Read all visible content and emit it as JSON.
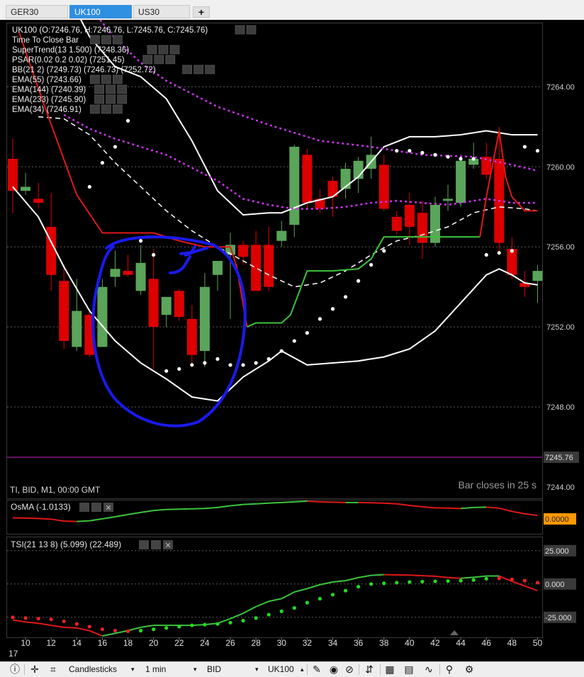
{
  "tabs": [
    {
      "label": "GER30"
    },
    {
      "label": "UK100"
    },
    {
      "label": "US30"
    }
  ],
  "add_tab_label": "+",
  "main": {
    "legend": [
      "UK100 (O:7246.76, H:7246.76, L:7245.76, C:7245.76)",
      "Time To Close Bar",
      "SuperTrend(13 1.500) (7248.36)",
      "PSAR(0.02 0.2 0.02) (7251.45)",
      "BB(21 2) (7249.73) (7246.73) (7252.72)",
      "EMA(55) (7243.66)",
      "EMA(144) (7240.39)",
      "EMA(233) (7245.90)",
      "EMA(34) (7246.91)"
    ],
    "y_labels": [
      "7264.00",
      "7260.00",
      "7256.00",
      "7252.00",
      "7248.00",
      "7244.00"
    ],
    "current_price": "7245.76",
    "info_text": "TI, BID, M1, 00:00 GMT",
    "bar_close_text": "Bar closes in 25 s"
  },
  "osma": {
    "title": "OsMA (-1.0133)",
    "value_label": "0.0000"
  },
  "tsi": {
    "title": "TSI(21 13 8) (5.099) (22.489)",
    "y_labels": [
      "25.000",
      "0.000",
      "-25.000"
    ]
  },
  "x_axis": {
    "labels": [
      "10",
      "12",
      "14",
      "16",
      "18",
      "20",
      "22",
      "24",
      "26",
      "28",
      "30",
      "32",
      "34",
      "36",
      "38",
      "40",
      "42",
      "44",
      "46",
      "48",
      "50"
    ],
    "corner": "17"
  },
  "toolbar": {
    "chart_type": "Candlesticks",
    "timeframe": "1 min",
    "price_type": "BID",
    "symbol": "UK100"
  },
  "colors": {
    "bull": "#5aa55a",
    "bear": "#dd0000",
    "supertrend_up": "#3cc43c",
    "supertrend_down": "#e01818",
    "ema_dotted": "#cc33ee",
    "annotation": "#1a1aee",
    "price_line": "#d020d0"
  },
  "chart_data": {
    "type": "candlestick",
    "x": [
      9,
      10,
      11,
      12,
      13,
      14,
      15,
      16,
      17,
      18,
      19,
      20,
      21,
      22,
      23,
      24,
      25,
      26,
      27,
      28,
      29,
      30,
      31,
      32,
      33,
      34,
      35,
      36,
      37,
      38,
      39,
      40,
      41,
      42,
      43,
      44,
      45,
      46,
      47,
      48,
      49,
      50
    ],
    "candles": [
      {
        "o": 7260.4,
        "h": 7261.4,
        "l": 7257.7,
        "c": 7258.8
      },
      {
        "o": 7258.8,
        "h": 7259.7,
        "l": 7258.6,
        "c": 7259.0
      },
      {
        "o": 7258.4,
        "h": 7259.2,
        "l": 7257.9,
        "c": 7258.2
      },
      {
        "o": 7257.0,
        "h": 7258.7,
        "l": 7253.8,
        "c": 7254.6
      },
      {
        "o": 7254.3,
        "h": 7255.1,
        "l": 7250.9,
        "c": 7251.3
      },
      {
        "o": 7251.0,
        "h": 7254.4,
        "l": 7250.8,
        "c": 7252.8
      },
      {
        "o": 7252.6,
        "h": 7252.8,
        "l": 7250.5,
        "c": 7250.6
      },
      {
        "o": 7251.0,
        "h": 7254.4,
        "l": 7251.0,
        "c": 7254.0
      },
      {
        "o": 7254.5,
        "h": 7255.8,
        "l": 7254.0,
        "c": 7254.9
      },
      {
        "o": 7254.8,
        "h": 7255.6,
        "l": 7254.5,
        "c": 7254.6
      },
      {
        "o": 7253.8,
        "h": 7256.1,
        "l": 7253.6,
        "c": 7255.2
      },
      {
        "o": 7254.4,
        "h": 7255.9,
        "l": 7249.9,
        "c": 7252.0
      },
      {
        "o": 7252.6,
        "h": 7253.3,
        "l": 7252.0,
        "c": 7253.5
      },
      {
        "o": 7253.8,
        "h": 7253.9,
        "l": 7252.3,
        "c": 7252.5
      },
      {
        "o": 7252.4,
        "h": 7253.1,
        "l": 7250.2,
        "c": 7250.6
      },
      {
        "o": 7250.8,
        "h": 7254.7,
        "l": 7250.0,
        "c": 7254.0
      },
      {
        "o": 7254.6,
        "h": 7255.3,
        "l": 7253.8,
        "c": 7255.3
      },
      {
        "o": 7255.6,
        "h": 7256.7,
        "l": 7252.4,
        "c": 7256.1
      },
      {
        "o": 7256.1,
        "h": 7256.3,
        "l": 7255.1,
        "c": 7255.5
      },
      {
        "o": 7256.1,
        "h": 7256.8,
        "l": 7253.8,
        "c": 7253.8
      },
      {
        "o": 7256.1,
        "h": 7257.0,
        "l": 7253.8,
        "c": 7254.0
      },
      {
        "o": 7256.3,
        "h": 7257.3,
        "l": 7256.0,
        "c": 7256.8
      },
      {
        "o": 7257.1,
        "h": 7261.1,
        "l": 7256.5,
        "c": 7261.0
      },
      {
        "o": 7260.6,
        "h": 7260.9,
        "l": 7257.9,
        "c": 7258.2
      },
      {
        "o": 7258.4,
        "h": 7258.9,
        "l": 7257.7,
        "c": 7257.9
      },
      {
        "o": 7259.3,
        "h": 7259.5,
        "l": 7257.5,
        "c": 7258.5
      },
      {
        "o": 7258.9,
        "h": 7260.2,
        "l": 7258.4,
        "c": 7259.9
      },
      {
        "o": 7259.4,
        "h": 7260.5,
        "l": 7258.7,
        "c": 7260.3
      },
      {
        "o": 7259.9,
        "h": 7261.5,
        "l": 7259.4,
        "c": 7260.6
      },
      {
        "o": 7260.1,
        "h": 7260.6,
        "l": 7257.8,
        "c": 7257.9
      },
      {
        "o": 7257.5,
        "h": 7257.8,
        "l": 7256.6,
        "c": 7256.8
      },
      {
        "o": 7258.1,
        "h": 7258.7,
        "l": 7256.1,
        "c": 7257.0
      },
      {
        "o": 7257.7,
        "h": 7258.3,
        "l": 7255.4,
        "c": 7256.2
      },
      {
        "o": 7256.2,
        "h": 7258.5,
        "l": 7256.0,
        "c": 7258.1
      },
      {
        "o": 7258.3,
        "h": 7259.1,
        "l": 7257.8,
        "c": 7258.4
      },
      {
        "o": 7258.2,
        "h": 7260.6,
        "l": 7258.0,
        "c": 7260.3
      },
      {
        "o": 7260.1,
        "h": 7261.2,
        "l": 7259.9,
        "c": 7260.4
      },
      {
        "o": 7260.5,
        "h": 7261.2,
        "l": 7259.4,
        "c": 7259.6
      },
      {
        "o": 7260.4,
        "h": 7262.0,
        "l": 7255.6,
        "c": 7256.2
      },
      {
        "o": 7255.9,
        "h": 7256.5,
        "l": 7254.4,
        "c": 7254.6
      },
      {
        "o": 7254.2,
        "h": 7254.8,
        "l": 7253.5,
        "c": 7254.0
      },
      {
        "o": 7254.3,
        "h": 7255.1,
        "l": 7253.2,
        "c": 7254.8
      }
    ],
    "xlim": [
      9,
      50
    ],
    "ylim": [
      7243.4,
      7267.2
    ],
    "y_ticks": [
      7244,
      7248,
      7252,
      7256,
      7260,
      7264
    ],
    "bb_upper": [
      [
        9,
        7259.0
      ],
      [
        11,
        7257.5
      ],
      [
        13,
        7255.0
      ],
      [
        15,
        7252.8
      ],
      [
        17,
        7251.3
      ],
      [
        19,
        7250.2
      ],
      [
        21,
        7249.4
      ],
      [
        23,
        7248.5
      ],
      [
        25,
        7248.3
      ],
      [
        27,
        7249.5
      ],
      [
        29,
        7250.3
      ],
      [
        30,
        7250.8
      ],
      [
        32,
        7250.1
      ],
      [
        34,
        7250.2
      ],
      [
        36,
        7250.3
      ],
      [
        38,
        7250.5
      ],
      [
        40,
        7250.9
      ],
      [
        42,
        7251.8
      ],
      [
        44,
        7253.2
      ],
      [
        46,
        7254.6
      ],
      [
        47,
        7254.9
      ],
      [
        48,
        7254.6
      ],
      [
        49,
        7254.2
      ],
      [
        50,
        7254.1
      ]
    ],
    "bb_lower": [
      [
        9,
        7272.0
      ],
      [
        11,
        7271.0
      ],
      [
        13,
        7269.0
      ],
      [
        15,
        7266.5
      ],
      [
        17,
        7265.0
      ],
      [
        19,
        7264.5
      ],
      [
        21,
        7263.4
      ],
      [
        23,
        7261.3
      ],
      [
        25,
        7258.8
      ],
      [
        27,
        7257.6
      ],
      [
        29,
        7257.7
      ],
      [
        30,
        7257.7
      ],
      [
        32,
        7258.2
      ],
      [
        34,
        7258.5
      ],
      [
        36,
        7259.5
      ],
      [
        38,
        7261.0
      ],
      [
        40,
        7261.5
      ],
      [
        42,
        7261.5
      ],
      [
        44,
        7261.6
      ],
      [
        46,
        7261.8
      ],
      [
        48,
        7261.6
      ],
      [
        50,
        7261.6
      ]
    ],
    "ema_dashed": [
      [
        11,
        7262.5
      ],
      [
        13,
        7262.4
      ],
      [
        15,
        7261.6
      ],
      [
        17,
        7260.2
      ],
      [
        19,
        7259.0
      ],
      [
        21,
        7257.8
      ],
      [
        23,
        7256.8
      ],
      [
        25,
        7256.0
      ],
      [
        27,
        7255.3
      ],
      [
        29,
        7254.6
      ],
      [
        31,
        7254.0
      ],
      [
        33,
        7254.2
      ],
      [
        35,
        7254.8
      ],
      [
        37,
        7255.6
      ],
      [
        39,
        7256.3
      ],
      [
        41,
        7256.6
      ],
      [
        43,
        7257.0
      ],
      [
        45,
        7257.7
      ],
      [
        47,
        7258.0
      ],
      [
        49,
        7257.9
      ],
      [
        50,
        7257.8
      ]
    ],
    "ema_dotted_1": [
      [
        13,
        7270.0
      ],
      [
        15,
        7268.0
      ],
      [
        17,
        7266.4
      ],
      [
        19,
        7265.2
      ],
      [
        21,
        7264.3
      ],
      [
        25,
        7263.0
      ],
      [
        29,
        7262.1
      ],
      [
        33,
        7261.3
      ],
      [
        37,
        7261.0
      ],
      [
        41,
        7260.6
      ],
      [
        45,
        7260.5
      ],
      [
        48,
        7260.1
      ],
      [
        50,
        7259.8
      ]
    ],
    "ema_dotted_2": [
      [
        13,
        7262.6
      ],
      [
        15,
        7261.9
      ],
      [
        17,
        7261.4
      ],
      [
        19,
        7261.0
      ],
      [
        21,
        7260.6
      ],
      [
        25,
        7259.3
      ],
      [
        27,
        7258.4
      ],
      [
        29,
        7258.1
      ],
      [
        31,
        7257.9
      ],
      [
        33,
        7257.9
      ],
      [
        35,
        7258.0
      ],
      [
        37,
        7258.2
      ],
      [
        39,
        7258.3
      ],
      [
        43,
        7258.1
      ],
      [
        46,
        7258.4
      ],
      [
        48,
        7258.2
      ],
      [
        50,
        7258.2
      ]
    ],
    "supertrend_down": [
      [
        9.5,
        7266.7
      ],
      [
        11.5,
        7263.0
      ],
      [
        14,
        7258.6
      ],
      [
        16,
        7256.7
      ],
      [
        20,
        7256.7
      ],
      [
        22,
        7256.3
      ],
      [
        24,
        7256.0
      ],
      [
        26,
        7256.0
      ],
      [
        26.5,
        7255.0
      ],
      [
        27.3,
        7252.0
      ]
    ],
    "supertrend_up": [
      [
        27.3,
        7252.0
      ],
      [
        28,
        7252.2
      ],
      [
        30,
        7252.2
      ],
      [
        30.7,
        7252.6
      ],
      [
        32,
        7254.8
      ],
      [
        34,
        7254.8
      ],
      [
        36,
        7254.9
      ],
      [
        37,
        7255.4
      ],
      [
        38,
        7256.5
      ],
      [
        40,
        7256.5
      ],
      [
        42,
        7256.5
      ],
      [
        45.5,
        7256.5
      ]
    ],
    "supertrend_spike": [
      [
        45.5,
        7256.5
      ],
      [
        46,
        7258.5
      ],
      [
        47,
        7261.8
      ],
      [
        47.5,
        7259.5
      ],
      [
        48,
        7258.5
      ],
      [
        49,
        7257.8
      ],
      [
        50,
        7257.8
      ]
    ],
    "psar": [
      [
        15,
        7259.0
      ],
      [
        16,
        7260.2
      ],
      [
        17,
        7261.0
      ],
      [
        18,
        7262.3
      ],
      [
        19,
        7256.3
      ],
      [
        20,
        7255.6
      ],
      [
        21,
        7249.8
      ],
      [
        22,
        7249.9
      ],
      [
        23,
        7250.1
      ],
      [
        24,
        7250.2
      ],
      [
        25,
        7250.4
      ],
      [
        26,
        7250.1
      ],
      [
        27,
        7250.1
      ],
      [
        28,
        7250.2
      ],
      [
        29,
        7250.4
      ],
      [
        30,
        7250.8
      ],
      [
        31,
        7251.3
      ],
      [
        32,
        7251.7
      ],
      [
        33,
        7252.4
      ],
      [
        34,
        7252.9
      ],
      [
        35,
        7253.5
      ],
      [
        36,
        7254.3
      ],
      [
        37,
        7255.1
      ],
      [
        38,
        7255.8
      ],
      [
        39,
        7260.8
      ],
      [
        40,
        7260.8
      ],
      [
        41,
        7260.7
      ],
      [
        42,
        7260.6
      ],
      [
        43,
        7260.5
      ],
      [
        44,
        7260.4
      ],
      [
        45,
        7260.4
      ],
      [
        46,
        7255.6
      ],
      [
        47,
        7255.7
      ],
      [
        48,
        7255.8
      ],
      [
        49,
        7261.0
      ],
      [
        50,
        7260.8
      ]
    ],
    "osma": {
      "ylim": [
        -0.6,
        0.4
      ],
      "values": [
        -0.12,
        -0.13,
        -0.14,
        -0.16,
        -0.22,
        -0.23,
        -0.21,
        -0.15,
        -0.09,
        -0.02,
        0.04,
        0.1,
        0.13,
        0.14,
        0.15,
        0.16,
        0.19,
        0.24,
        0.28,
        0.3,
        0.32,
        0.34,
        0.36,
        0.38,
        0.36,
        0.35,
        0.34,
        0.34,
        0.33,
        0.32,
        0.3,
        0.25,
        0.21,
        0.18,
        0.17,
        0.16,
        0.19,
        0.2,
        0.17,
        0.07,
        0.0,
        -0.05
      ]
    },
    "tsi": {
      "ylim": [
        -40,
        35
      ],
      "y_ticks": [
        25,
        0,
        -25
      ],
      "tsi": [
        -27.0,
        -28.5,
        -29.5,
        -31.0,
        -32.5,
        -33.0,
        -35.0,
        -39.0,
        -37.0,
        -35.0,
        -32.5,
        -31.0,
        -31.0,
        -31.0,
        -31.0,
        -30.5,
        -29.5,
        -26.0,
        -22.0,
        -17.0,
        -13.0,
        -11.0,
        -6.0,
        -3.5,
        -0.5,
        1.5,
        2.5,
        4.8,
        6.5,
        7.0,
        6.8,
        6.7,
        6.2,
        5.8,
        4.8,
        4.3,
        5.0,
        6.0,
        6.0,
        2.0,
        -1.5,
        -5.0
      ],
      "signal": [
        -25.0,
        -25.5,
        -26.0,
        -26.5,
        -28.0,
        -30.0,
        -32.0,
        -34.0,
        -35.0,
        -35.5,
        -35.0,
        -34.0,
        -33.0,
        -32.0,
        -31.0,
        -30.5,
        -30.0,
        -29.0,
        -27.5,
        -25.5,
        -23.0,
        -20.5,
        -18.0,
        -14.0,
        -11.0,
        -8.0,
        -5.0,
        -2.0,
        0.0,
        0.5,
        1.0,
        1.5,
        1.8,
        2.0,
        2.2,
        2.5,
        3.0,
        4.0,
        4.2,
        3.5,
        2.5,
        1.0
      ],
      "signal_color": [
        "red",
        "red",
        "red",
        "red",
        "red",
        "red",
        "red",
        "red",
        "red",
        "red",
        "green",
        "green",
        "green",
        "green",
        "green",
        "green",
        "green",
        "green",
        "green",
        "green",
        "green",
        "green",
        "green",
        "green",
        "green",
        "green",
        "green",
        "green",
        "green",
        "green",
        "green",
        "green",
        "green",
        "green",
        "green",
        "green",
        "green",
        "green",
        "red",
        "red",
        "red",
        "red"
      ]
    }
  }
}
